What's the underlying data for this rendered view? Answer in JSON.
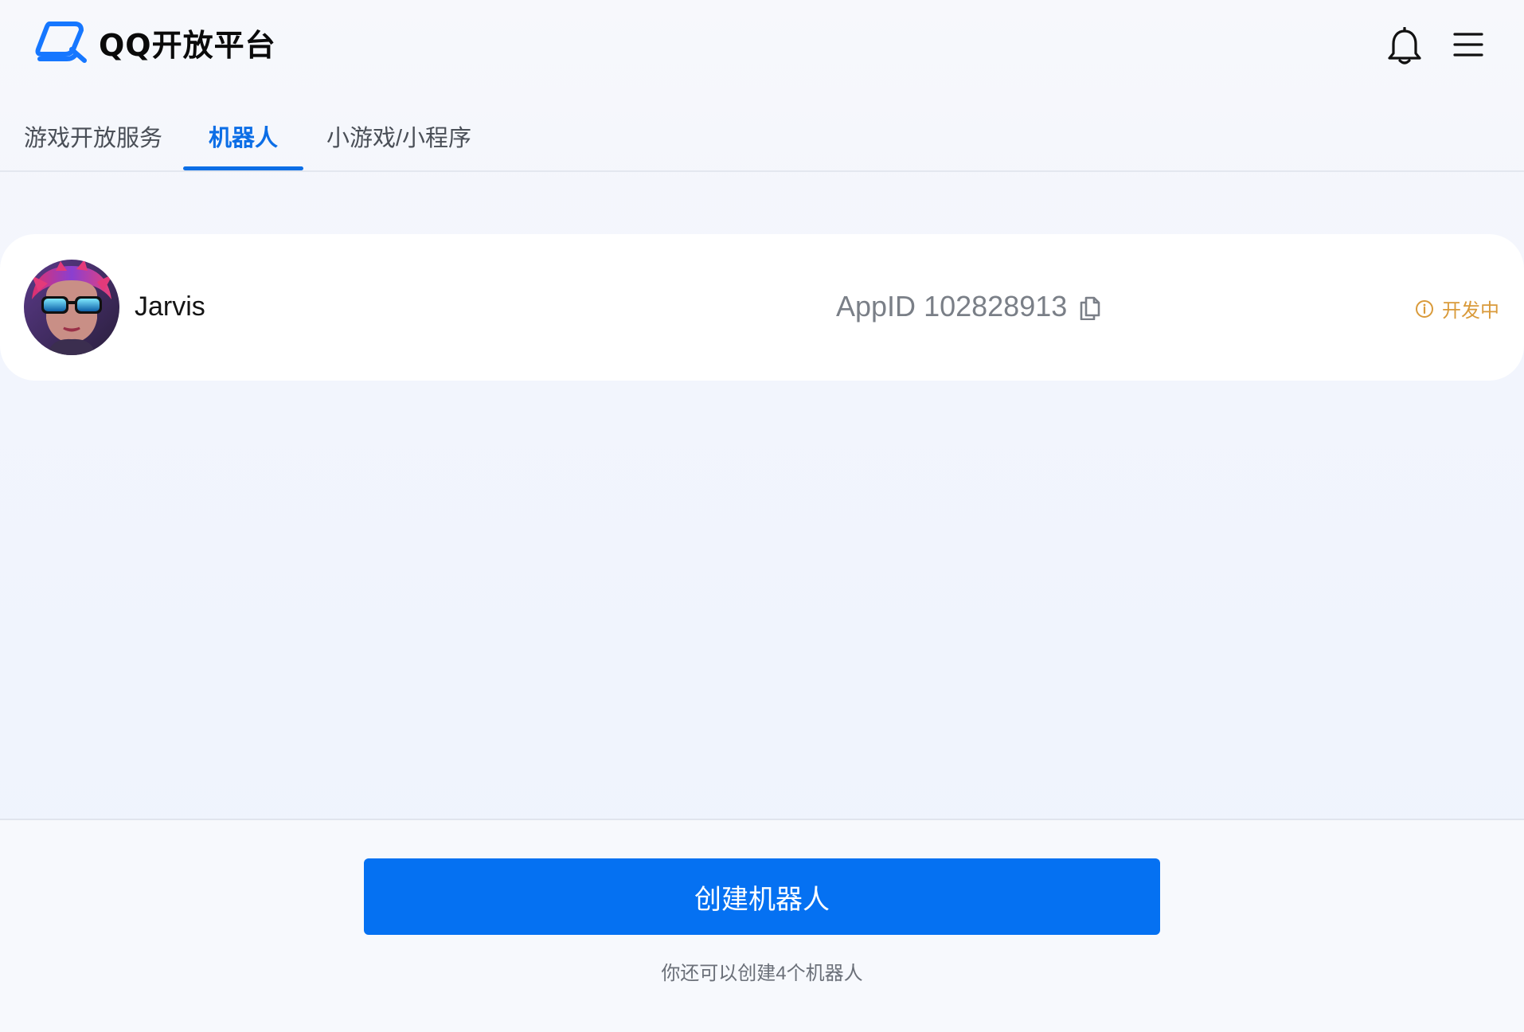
{
  "header": {
    "brand": "QQ开放平台",
    "brand_color": "#1677ff",
    "icons": {
      "notifications": "bell-icon",
      "menu": "hamburger-menu-icon"
    }
  },
  "tabs": [
    {
      "label": "游戏开放服务",
      "active": false
    },
    {
      "label": "机器人",
      "active": true
    },
    {
      "label": "小游戏/小程序",
      "active": false
    }
  ],
  "bot": {
    "name": "Jarvis",
    "appid_label": "AppID",
    "appid": "102828913",
    "copy_icon": "copy-icon",
    "status": "开发中",
    "status_icon": "info-circle-icon",
    "status_color": "#d99a3a"
  },
  "footer": {
    "create_label": "创建机器人",
    "create_color": "#0571f2",
    "hint": "你还可以创建4个机器人"
  },
  "colors": {
    "accent": "#0c6ee6",
    "background": "#f2f5fd"
  }
}
